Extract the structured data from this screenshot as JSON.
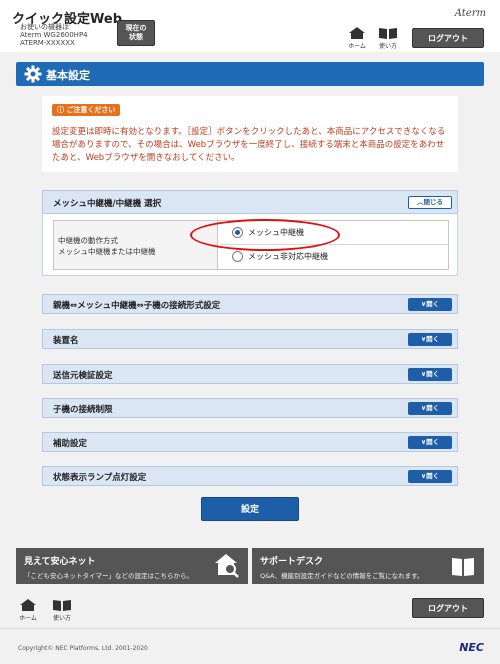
{
  "header": {
    "app_title": "クイック設定Web",
    "model_info_line1": "お使いの機器は",
    "model_info_line2": "Aterm WG2600HP4",
    "model_info_line3": "ATERM-XXXXXX",
    "status_line1": "現在の",
    "status_line2": "状態",
    "brand": "Aterm",
    "home_label": "ホーム",
    "howto_label": "使い方",
    "logout_label": "ログアウト"
  },
  "section": {
    "title": "基本設定"
  },
  "notice": {
    "badge": "ご注意ください",
    "text": "設定変更は即時に有効となります。［設定］ボタンをクリックしたあと、本商品にアクセスできなくなる場合がありますので、その場合は、Webブラウザを一度終了し、接続する端末と本商品の設定をあわせたあと、Webブラウザを開きなおしてください。"
  },
  "mesh_panel": {
    "title": "メッシュ中継機/中継機 選択",
    "toggle_label": "閉じる",
    "row_label_line1": "中継機の動作方式",
    "row_label_line2": "メッシュ中継機または中継機",
    "option1": "メッシュ中継機",
    "option2": "メッシュ非対応中継機",
    "selected": "メッシュ中継機"
  },
  "panels": [
    {
      "title": "親機⇔メッシュ中継機⇔子機の接続形式設定",
      "toggle_label": "開く"
    },
    {
      "title": "装置名",
      "toggle_label": "開く"
    },
    {
      "title": "送信元検証設定",
      "toggle_label": "開く"
    },
    {
      "title": "子機の接続制限",
      "toggle_label": "開く"
    },
    {
      "title": "補助設定",
      "toggle_label": "開く"
    },
    {
      "title": "状態表示ランプ点灯設定",
      "toggle_label": "開く"
    }
  ],
  "submit_label": "設定",
  "banners": {
    "left_title": "見えて安心ネット",
    "left_sub": "「こども安心ネットタイマー」などの設定はこちらから。",
    "right_title": "サポートデスク",
    "right_sub": "Q&A、機能別設定ガイドなどの情報をご覧になれます。"
  },
  "footer": {
    "home_label": "ホーム",
    "howto_label": "使い方",
    "logout_label": "ログアウト",
    "copyright": "Copyright© NEC Platforms, Ltd. 2001-2020",
    "logo": "NEC"
  },
  "colors": {
    "accent": "#1e5ea8",
    "notice_text": "#c03a1a",
    "highlight_circle": "#e01010"
  }
}
